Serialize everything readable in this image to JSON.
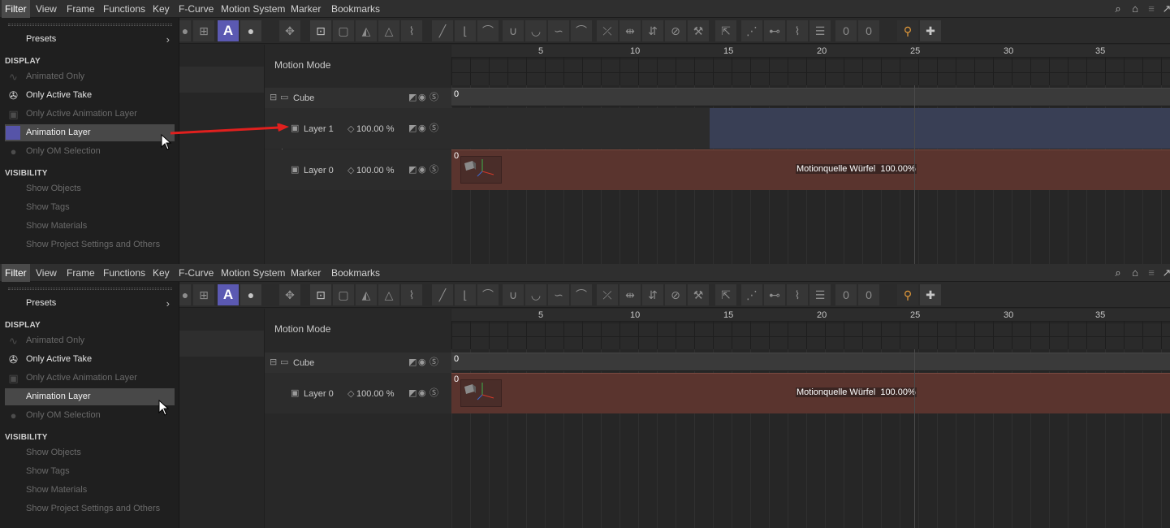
{
  "menu": [
    "Filter",
    "View",
    "Frame",
    "Functions",
    "Key",
    "F-Curve",
    "Motion System",
    "Marker",
    "Bookmarks"
  ],
  "dropdown": {
    "presets": "Presets",
    "display_heading": "DISPLAY",
    "display": [
      "Animated Only",
      "Only Active Take",
      "Only Active Animation Layer",
      "Animation Layer",
      "Only OM Selection"
    ],
    "visibility_heading": "VISIBILITY",
    "visibility": [
      "Show Objects",
      "Show Tags",
      "Show Materials",
      "Show Project Settings and Others"
    ]
  },
  "tree": {
    "motion_mode": "Motion Mode",
    "cube": "Cube",
    "layer1": "Layer 1",
    "layer0": "Layer 0",
    "layer1_weight": "100.00 %",
    "layer0_weight": "100.00 %"
  },
  "ruler": [
    "5",
    "10",
    "15",
    "20",
    "25",
    "30",
    "35"
  ],
  "timeline": {
    "zero": "0",
    "clip_label": "Motionquelle Würfel  100.00%"
  },
  "colors": {
    "accent": "#5b59b2",
    "clip": "#5a342e",
    "layer_band": "#393f55",
    "arrow": "#e0201e"
  }
}
